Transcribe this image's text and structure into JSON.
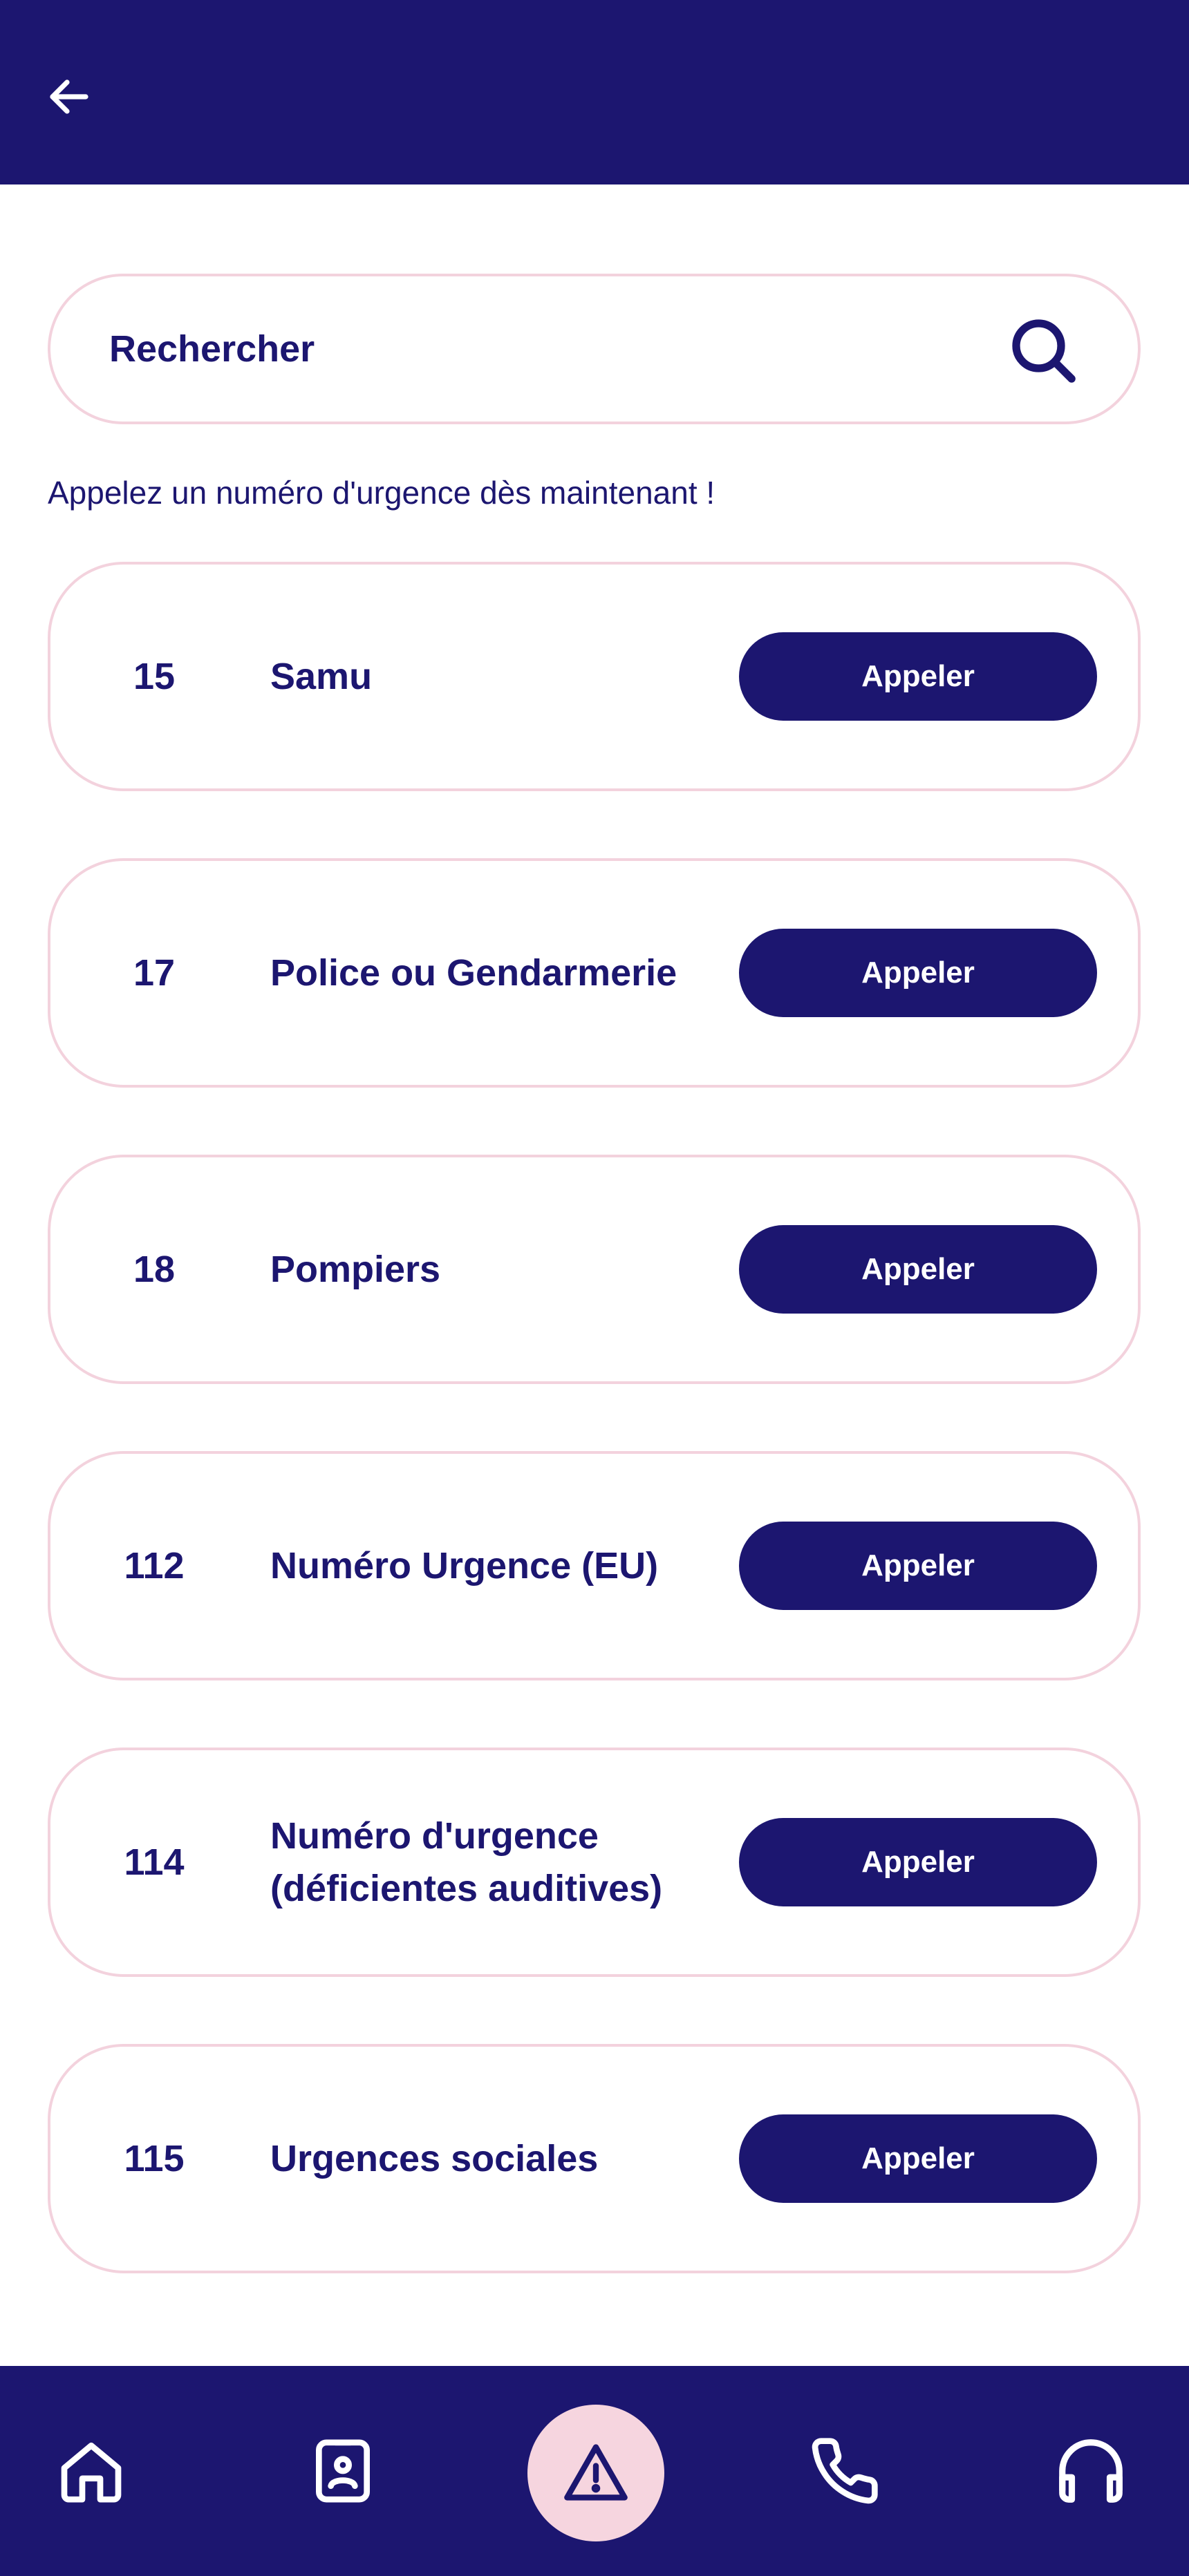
{
  "header": {
    "back_icon": "arrow-left-icon"
  },
  "search": {
    "placeholder": "Rechercher",
    "icon": "search-icon"
  },
  "intro_text": "Appelez un numéro d'urgence dès maintenant !",
  "emergency_numbers": [
    {
      "number": "15",
      "name": "Samu",
      "button_label": "Appeler"
    },
    {
      "number": "17",
      "name": "Police ou Gendarmerie",
      "button_label": "Appeler"
    },
    {
      "number": "18",
      "name": "Pompiers",
      "button_label": "Appeler"
    },
    {
      "number": "112",
      "name": "Numéro Urgence (EU)",
      "button_label": "Appeler"
    },
    {
      "number": "114",
      "name": "Numéro d'urgence\n(déficientes auditives)",
      "button_label": "Appeler"
    },
    {
      "number": "115",
      "name": "Urgences sociales",
      "button_label": "Appeler"
    }
  ],
  "bottom_nav": {
    "items": [
      "home-icon",
      "contact-card-icon",
      "warning-icon",
      "phone-icon",
      "headphones-icon"
    ],
    "active": "warning-icon"
  },
  "colors": {
    "primary": "#1c1670",
    "card_border": "#f3d2dd",
    "active_nav_bg": "#f6d5df",
    "background": "#ffffff"
  }
}
